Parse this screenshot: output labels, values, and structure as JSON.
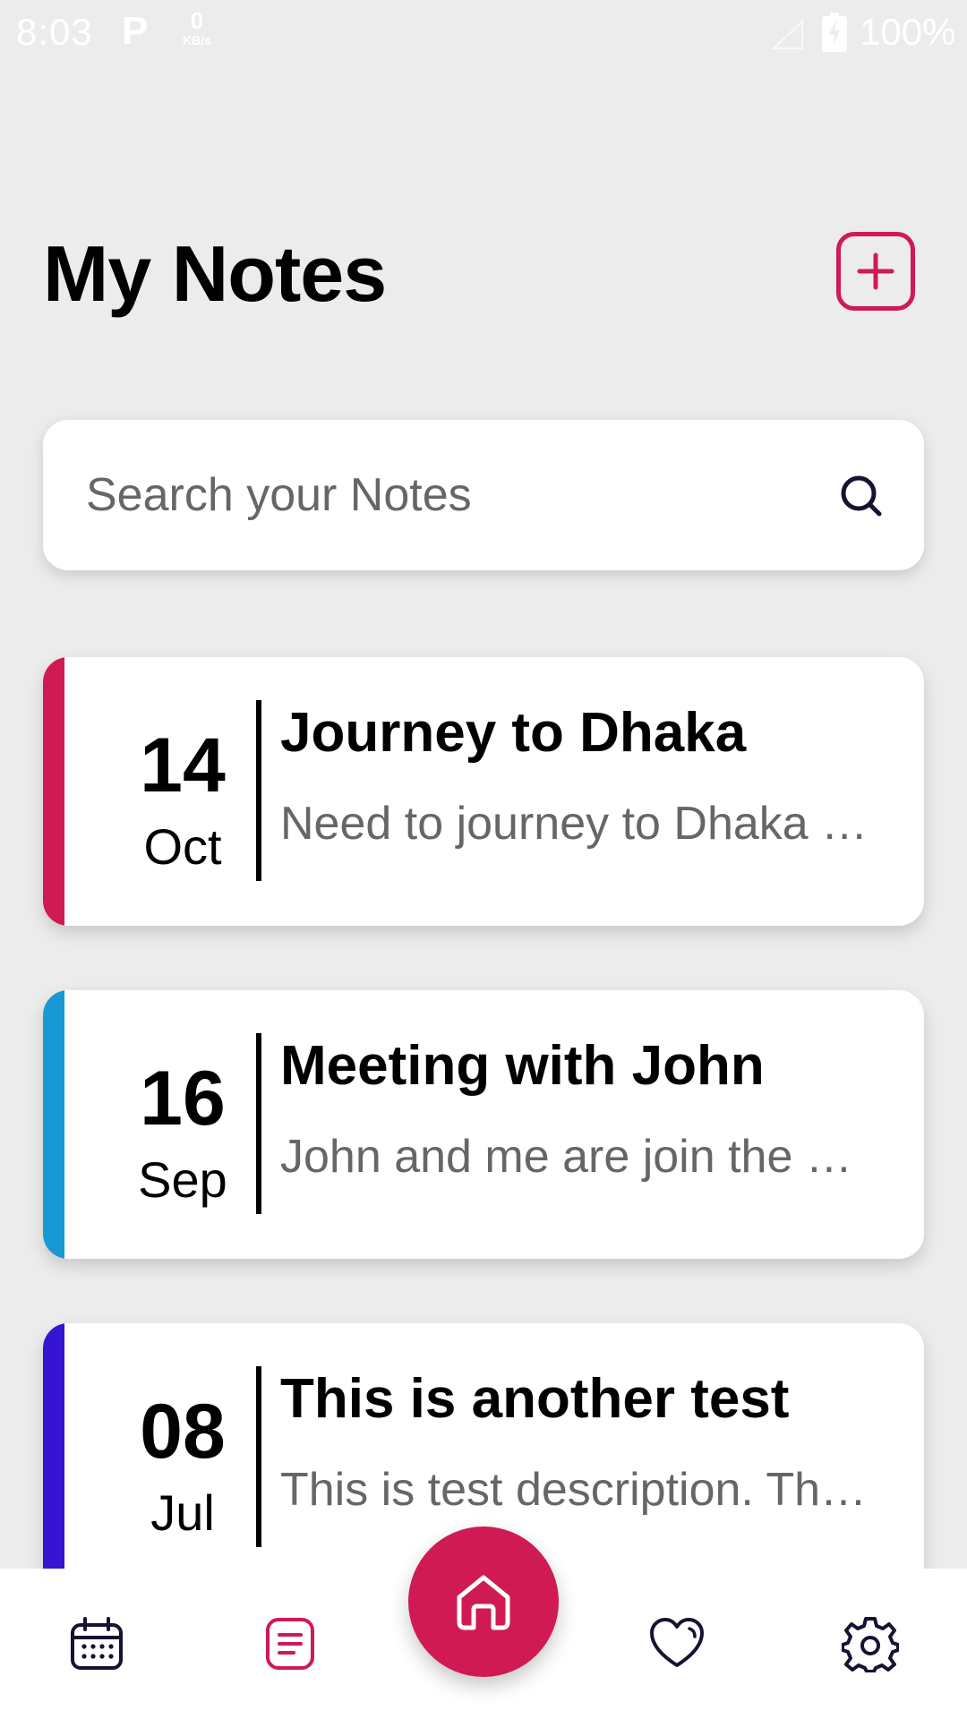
{
  "status_bar": {
    "time": "8:03",
    "app_badge": "P",
    "speed_value": "0",
    "speed_unit": "KB/s",
    "battery": "100%"
  },
  "header": {
    "title": "My Notes",
    "add_icon": "plus-square-icon"
  },
  "search": {
    "placeholder": "Search your Notes",
    "value": "",
    "icon": "search-icon"
  },
  "notes": [
    {
      "day": "14",
      "month": "Oct",
      "title": "Journey to Dhaka",
      "description": "Need to journey to Dhaka …",
      "accent_color": "#cf1a53"
    },
    {
      "day": "16",
      "month": "Sep",
      "title": "Meeting with John",
      "description": "John and me are join the …",
      "accent_color": "#1899d3"
    },
    {
      "day": "08",
      "month": "Jul",
      "title": "This is another test",
      "description": "This is test description. Th…",
      "accent_color": "#3514d2"
    }
  ],
  "bottom_nav": {
    "items": [
      {
        "icon": "calendar-icon",
        "active": false
      },
      {
        "icon": "notes-icon",
        "active": true
      },
      {
        "icon": "home-icon",
        "active": false
      },
      {
        "icon": "heart-icon",
        "active": false
      },
      {
        "icon": "gear-icon",
        "active": false
      }
    ]
  },
  "colors": {
    "accent": "#cf1a53",
    "background": "#ececec",
    "card": "#ffffff"
  }
}
